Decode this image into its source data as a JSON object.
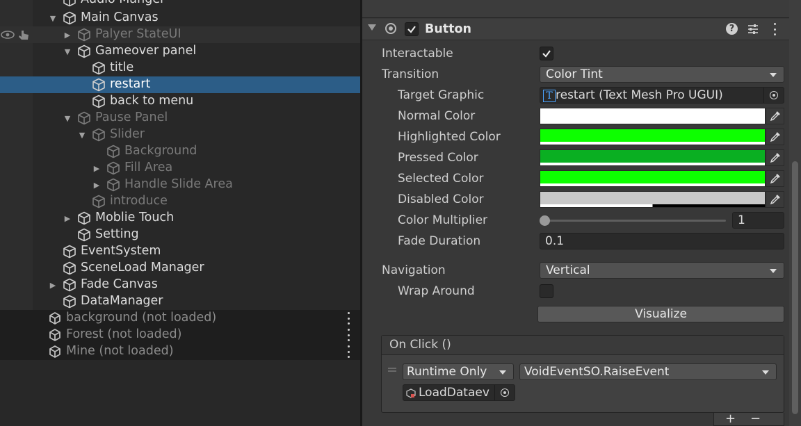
{
  "hierarchy": {
    "items": [
      {
        "label": "Audio Manger"
      },
      {
        "label": "Main Canvas"
      },
      {
        "label": "Palyer StateUI"
      },
      {
        "label": "Gameover panel"
      },
      {
        "label": "title"
      },
      {
        "label": "restart"
      },
      {
        "label": "back to menu"
      },
      {
        "label": "Pause Panel"
      },
      {
        "label": "Slider"
      },
      {
        "label": "Background"
      },
      {
        "label": "Fill Area"
      },
      {
        "label": "Handle Slide Area"
      },
      {
        "label": "introduce"
      },
      {
        "label": "Moblie Touch"
      },
      {
        "label": "Setting"
      },
      {
        "label": "EventSystem"
      },
      {
        "label": "SceneLoad Manager"
      },
      {
        "label": "Fade Canvas"
      },
      {
        "label": "DataManager"
      }
    ],
    "scenes": [
      {
        "label": "background (not loaded)"
      },
      {
        "label": "Forest (not loaded)"
      },
      {
        "label": "Mine (not loaded)"
      }
    ]
  },
  "inspector": {
    "component": {
      "title": "Button",
      "enabled": true,
      "icons": [
        "help-icon",
        "presets-icon",
        "kebab-menu-icon"
      ]
    },
    "properties": {
      "interactable_label": "Interactable",
      "interactable": true,
      "transition_label": "Transition",
      "transition_value": "Color Tint",
      "target_graphic_label": "Target Graphic",
      "target_graphic_value": "restart (Text Mesh Pro UGUI)",
      "target_graphic_icon_glyph": "T",
      "colors": [
        {
          "label": "Normal Color",
          "color": "#ffffff"
        },
        {
          "label": "Highlighted Color",
          "color": "#0dff00"
        },
        {
          "label": "Pressed Color",
          "color": "#0aaf22"
        },
        {
          "label": "Selected Color",
          "color": "#0dff00"
        },
        {
          "label": "Disabled Color",
          "color": "#c8c8c8"
        }
      ],
      "color_multiplier_label": "Color Multiplier",
      "color_multiplier_value": "1",
      "color_multiplier_slider": 0,
      "fade_duration_label": "Fade Duration",
      "fade_duration_value": "0.1",
      "navigation_label": "Navigation",
      "navigation_value": "Vertical",
      "wrap_around_label": "Wrap Around",
      "wrap_around": false,
      "visualize_label": "Visualize"
    },
    "on_click": {
      "header": "On Click ()",
      "runtime_value": "Runtime Only",
      "function_value": "VoidEventSO.RaiseEvent",
      "object_value": "LoadDataev",
      "add_label": "+",
      "remove_label": "−"
    }
  }
}
